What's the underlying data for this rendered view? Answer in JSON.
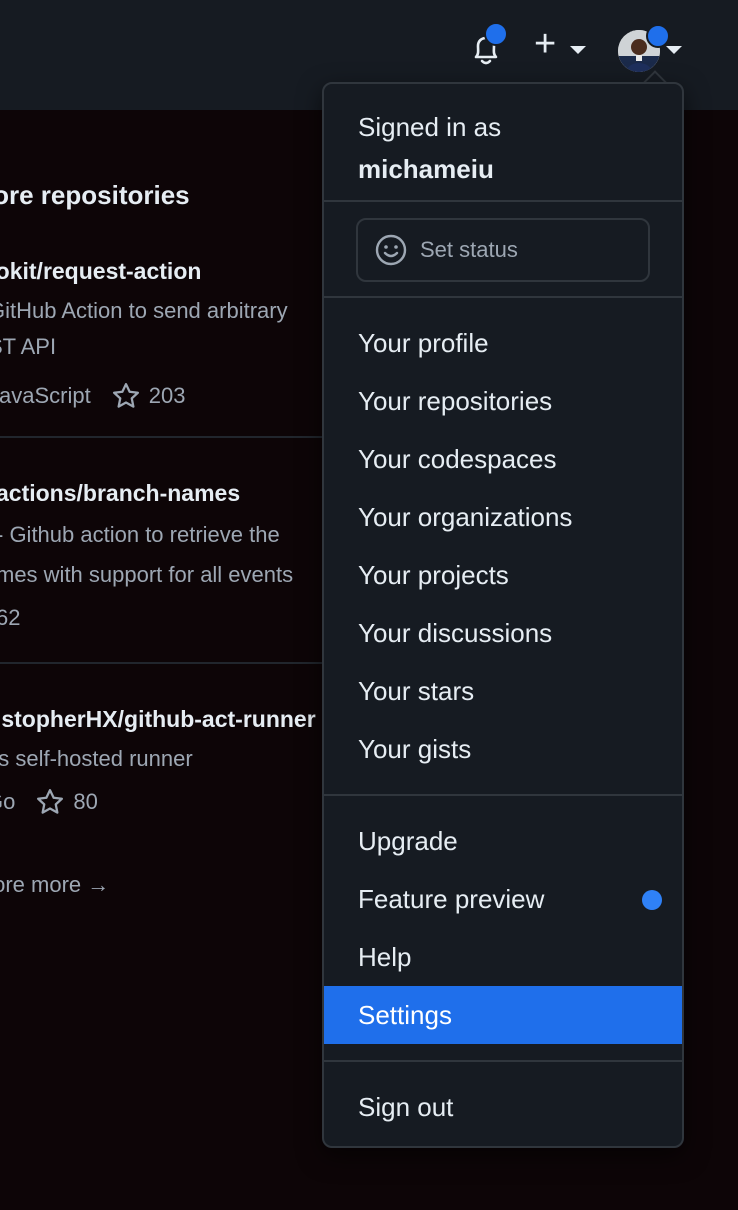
{
  "header": {
    "icons": [
      "bell-icon",
      "plus-icon",
      "avatar"
    ],
    "accent": "#1f6feb"
  },
  "explore": {
    "title": "plore repositories",
    "repos": [
      {
        "name": "tokit/request-action",
        "desc_line1": "GitHub Action to send arbitrary",
        "desc_line2": "ST API",
        "language": "JavaScript",
        "stars": "203"
      },
      {
        "name": "actions/branch-names",
        "desc_line1": "- Github action to retrieve the",
        "desc_line2": "mes with support for all events",
        "language": "",
        "stars": "62"
      },
      {
        "name": "ristopherHX/github-act-runner",
        "desc_line1": " as self-hosted runner",
        "desc_line2": "",
        "language": "Go",
        "stars": "80"
      }
    ],
    "more": "plore more →"
  },
  "menu": {
    "signed_in_as": "Signed in as",
    "username": "michameiu",
    "set_status": "Set status",
    "group1": [
      "Your profile",
      "Your repositories",
      "Your codespaces",
      "Your organizations",
      "Your projects",
      "Your discussions",
      "Your stars",
      "Your gists"
    ],
    "group2": [
      "Upgrade",
      "Feature preview",
      "Help",
      "Settings"
    ],
    "sign_out": "Sign out",
    "active_item": "Settings"
  }
}
